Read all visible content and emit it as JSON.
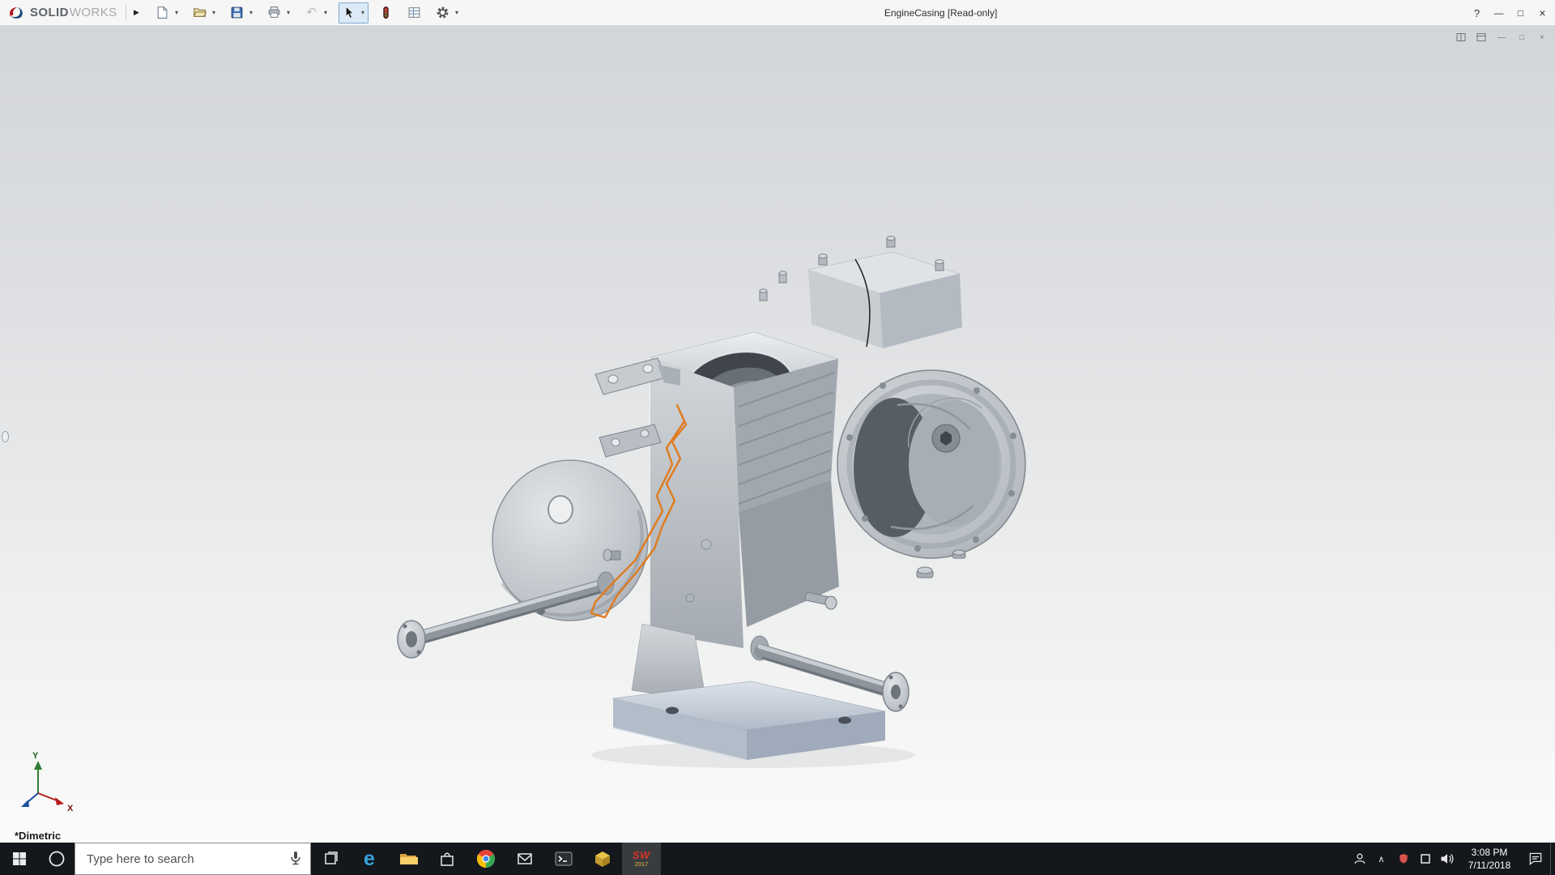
{
  "window": {
    "brand_bold": "SOLID",
    "brand_light": "WORKS",
    "title": "EngineCasing [Read-only]"
  },
  "icons": {
    "flyout": "▶",
    "dropdown": "▾",
    "help": "?",
    "minimize": "—",
    "maximize": "□",
    "close": "×",
    "undo": "↶",
    "edge_letter": "e",
    "tray_chevron": "∧"
  },
  "toolbar_tools": [
    "new-document",
    "open",
    "save",
    "print",
    "undo",
    "select",
    "rebuild",
    "design-table",
    "options"
  ],
  "colors": {
    "sketch_highlight": "#e07818",
    "taskbar_bg": "#14171b",
    "titlebar_bg": "#f6f6f6"
  },
  "viewport": {
    "view_label": "*Dimetric",
    "triad": {
      "x": "X",
      "y": "Y"
    }
  },
  "taskbar": {
    "search_placeholder": "Type here to search",
    "sw_badge": {
      "name": "SW",
      "year": "2017"
    },
    "clock": {
      "time": "3:08 PM",
      "date": "7/11/2018"
    }
  }
}
